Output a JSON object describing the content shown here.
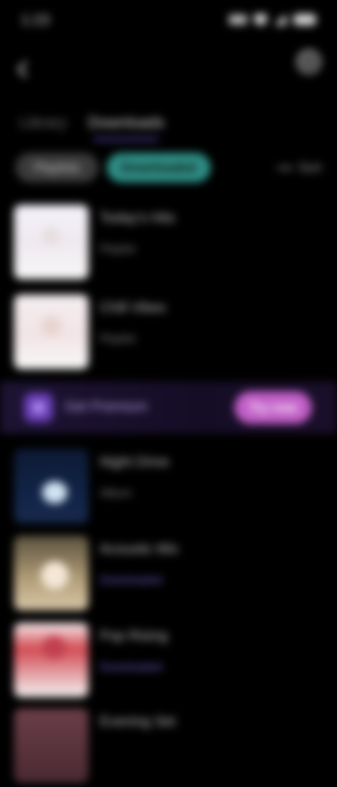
{
  "status_bar": {
    "time": "1:23",
    "icons": [
      "network-icon",
      "wifi-icon",
      "signal-icon",
      "battery-icon"
    ]
  },
  "top_bar": {
    "back_icon": "back-arrow-icon",
    "search_icon": "search-icon"
  },
  "tabs": [
    {
      "label": "Library",
      "active": false
    },
    {
      "label": "Downloads",
      "active": true
    }
  ],
  "filters": {
    "chip_1": "Playlists",
    "chip_2": "Downloaded",
    "sort_label": "Sort"
  },
  "items": [
    {
      "title": "Today's Hits",
      "subtitle": "Playlist"
    },
    {
      "title": "Chill Vibes",
      "subtitle": "Playlist"
    },
    {
      "title": "Night Drive",
      "subtitle": "Album"
    },
    {
      "title": "Acoustic Mix",
      "subtitle": "Downloaded"
    },
    {
      "title": "Pop Rising",
      "subtitle": "Downloaded"
    },
    {
      "title": "Evening Set",
      "subtitle": ""
    }
  ],
  "promo": {
    "text": "Get Premium",
    "button_label": "Try now"
  },
  "colors": {
    "accent_teal": "#2e8f86",
    "accent_purple": "#6e5ae6",
    "promo_pink": "#c25fc8"
  }
}
